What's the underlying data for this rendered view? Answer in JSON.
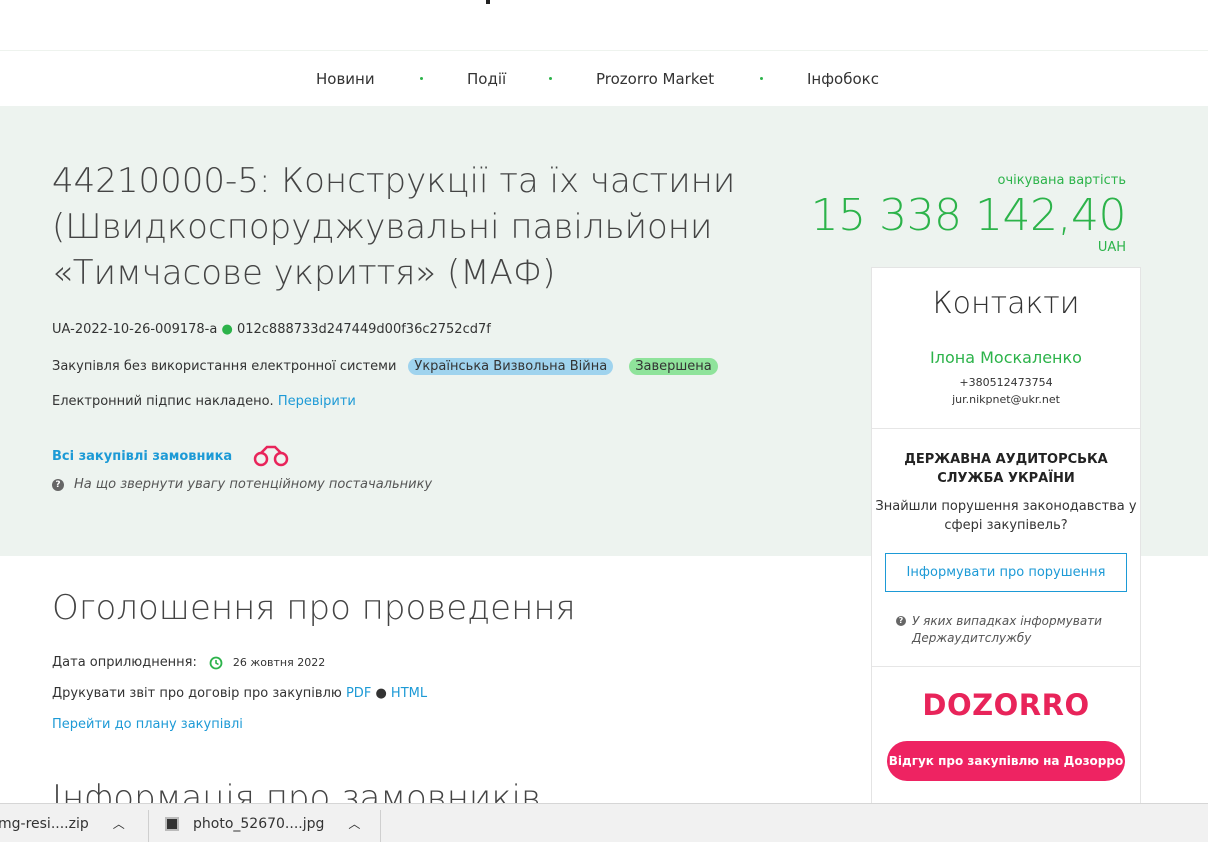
{
  "nav": {
    "items": [
      "Новини",
      "Події",
      "Prozorro Market",
      "Інфобокс"
    ]
  },
  "tender": {
    "title": "44210000-5: Конструкції та їх частини (Швидкоспоруджувальні павільйони «Тимчасове укриття» (МАФ)",
    "id": "UA-2022-10-26-009178-a",
    "hash": "012c888733d247449d00f36c2752cd7f",
    "procurement_type": "Закупівля без використання електронної системи",
    "badge_war": "Українська Визвольна Війна",
    "badge_status": "Завершена",
    "signature_text": "Електронний підпис накладено.",
    "verify_link": "Перевірити",
    "all_purchases": "Всі закупівлі замовника",
    "supplier_hint": "На що звернути увагу потенційному постачальнику"
  },
  "expected": {
    "label": "очікувана вартість",
    "amount": "15 338 142,40",
    "currency": "UAH"
  },
  "contacts": {
    "title": "Контакти",
    "name": "Ілона Москаленко",
    "phone": "+380512473754",
    "email": "jur.nikpnet@ukr.net"
  },
  "audit": {
    "org": "ДЕРЖАВНА АУДИТОРСЬКА СЛУЖБА УКРАЇНИ",
    "found": "Знайшли порушення законодавства у сфері закупівель?",
    "button": "Інформувати про порушення",
    "cases": "У яких випадках інформувати Держаудитслужбу"
  },
  "dozorro": {
    "logo": "DOZORRO",
    "button": "Відгук про закупівлю на Дозорро"
  },
  "announcement": {
    "title": "Оголошення про проведення",
    "pub_label": "Дата оприлюднення:",
    "pub_date": "26 жовтня 2022",
    "print_text": "Друкувати звіт про договір про закупівлю",
    "pdf": "PDF",
    "html": "HTML",
    "plan_link": "Перейти до плану закупівлі",
    "next_title": "Інформація про замовників"
  },
  "downloads": [
    {
      "name": "mg-resi....zip"
    },
    {
      "name": "photo_52670....jpg"
    }
  ],
  "colors": {
    "green": "#2cb34a",
    "link": "#1d9ad6",
    "hero_bg": "#edf3ef",
    "dozorro": "#ee2362"
  }
}
